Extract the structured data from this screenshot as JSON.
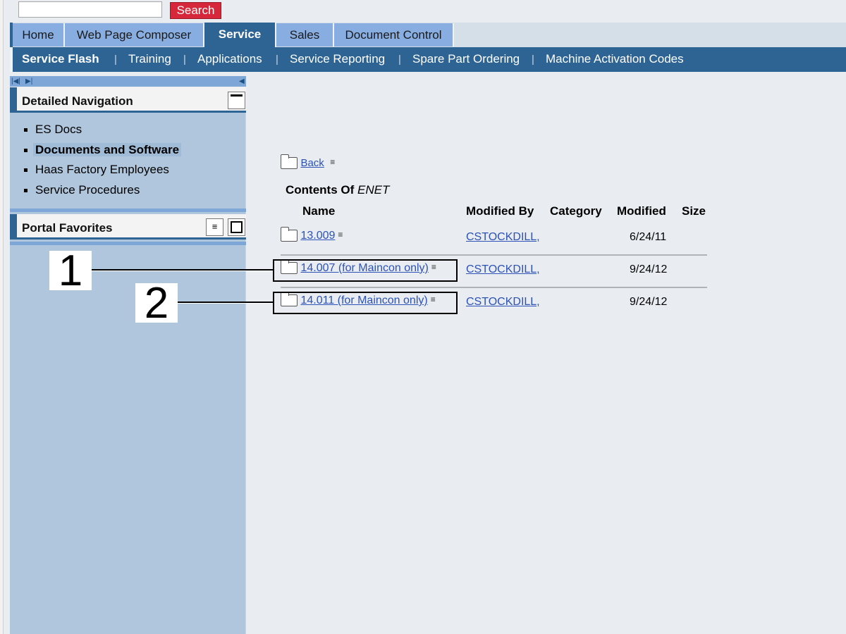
{
  "search": {
    "placeholder": "",
    "value": "",
    "button_label": "Search"
  },
  "tabs": [
    {
      "label": "Home",
      "active": false
    },
    {
      "label": "Web Page Composer",
      "active": false
    },
    {
      "label": "Service",
      "active": true
    },
    {
      "label": "Sales",
      "active": false
    },
    {
      "label": "Document Control",
      "active": false
    }
  ],
  "subnav": [
    {
      "label": "Service Flash",
      "active": true
    },
    {
      "label": "Training"
    },
    {
      "label": "Applications"
    },
    {
      "label": "Service Reporting"
    },
    {
      "label": "Spare Part Ordering"
    },
    {
      "label": "Machine Activation Codes"
    }
  ],
  "sidebar": {
    "detailed_nav": {
      "title": "Detailed Navigation",
      "items": [
        {
          "label": "ES Docs"
        },
        {
          "label": "Documents and Software",
          "selected": true
        },
        {
          "label": "Haas Factory Employees"
        },
        {
          "label": "Service Procedures"
        }
      ]
    },
    "favorites": {
      "title": "Portal Favorites"
    }
  },
  "content": {
    "back_label": "Back",
    "contents_of_label": "Contents Of",
    "folder_name": "ENET",
    "columns": [
      "Name",
      "Modified By",
      "Category",
      "Modified",
      "Size"
    ],
    "rows": [
      {
        "name": "13.009",
        "modified_by": "CSTOCKDILL,",
        "category": "",
        "modified": "6/24/11",
        "size": ""
      },
      {
        "name": "14.007 (for Maincon only)",
        "modified_by": "CSTOCKDILL,",
        "category": "",
        "modified": "9/24/12",
        "size": ""
      },
      {
        "name": "14.011 (for Maincon only)",
        "modified_by": "CSTOCKDILL,",
        "category": "",
        "modified": "9/24/12",
        "size": ""
      }
    ]
  },
  "callouts": [
    {
      "label": "1"
    },
    {
      "label": "2"
    }
  ]
}
